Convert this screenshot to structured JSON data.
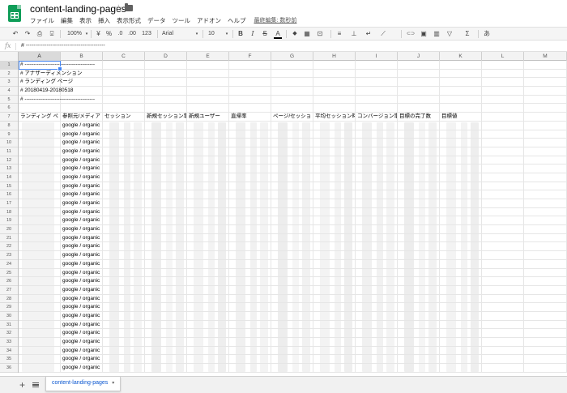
{
  "app": {
    "title": "content-landing-pages",
    "star": "☆",
    "menu": [
      "ファイル",
      "編集",
      "表示",
      "挿入",
      "表示形式",
      "データ",
      "ツール",
      "アドオン",
      "ヘルプ"
    ],
    "last_edit": "最終編集: 数秒前"
  },
  "toolbar": {
    "undo": "↶",
    "redo": "↷",
    "print": "⎙",
    "paint": "⍌",
    "zoom": "100%",
    "currency": "¥",
    "percent": "%",
    "dec_less": ".0",
    "dec_more": ".00",
    "more_formats": "123",
    "font": "Arial",
    "font_size": "10",
    "bold": "B",
    "italic": "I",
    "strike": "S",
    "text_color": "A",
    "fill": "◆",
    "borders": "▦",
    "merge": "⊡",
    "halign": "≡",
    "valign": "⊥",
    "wrap": "↵",
    "rotate": "⟋",
    "link": "⊂⊃",
    "comment": "▣",
    "chart": "▥",
    "filter": "▽",
    "functions": "Σ",
    "input_tools": "あ"
  },
  "formula": {
    "fx": "fx",
    "value": "# ------------------------------------------"
  },
  "columns": [
    "A",
    "B",
    "C",
    "D",
    "E",
    "F",
    "G",
    "H",
    "I",
    "J",
    "K",
    "L",
    "M"
  ],
  "rows": [
    "1",
    "2",
    "3",
    "4",
    "5",
    "6",
    "7",
    "8",
    "9",
    "10",
    "11",
    "12",
    "13",
    "14",
    "15",
    "16",
    "17",
    "18",
    "19",
    "20",
    "21",
    "22",
    "23",
    "24",
    "25",
    "26",
    "27",
    "28",
    "29",
    "30",
    "31",
    "32",
    "33",
    "34",
    "35",
    "36"
  ],
  "cells": {
    "r1a": "# ----------------------------------------",
    "r2a": "# アナザーディメンション",
    "r3a": "# ランディング ページ",
    "r4a": "# 20180419-20180518",
    "r5a": "# ----------------------------------------",
    "headers": [
      "ランディング ペ",
      "参照元/メディア",
      "セッション",
      "新規セッション率",
      "新規ユーザー",
      "直帰率",
      "ページ/セッショ",
      "平均セッション時",
      "コンバージョン率",
      "目標の完了数",
      "目標値"
    ],
    "source_value": "google / organic"
  },
  "sheet": {
    "add": "+",
    "tab": "content-landing-pages",
    "caret": "▾"
  }
}
